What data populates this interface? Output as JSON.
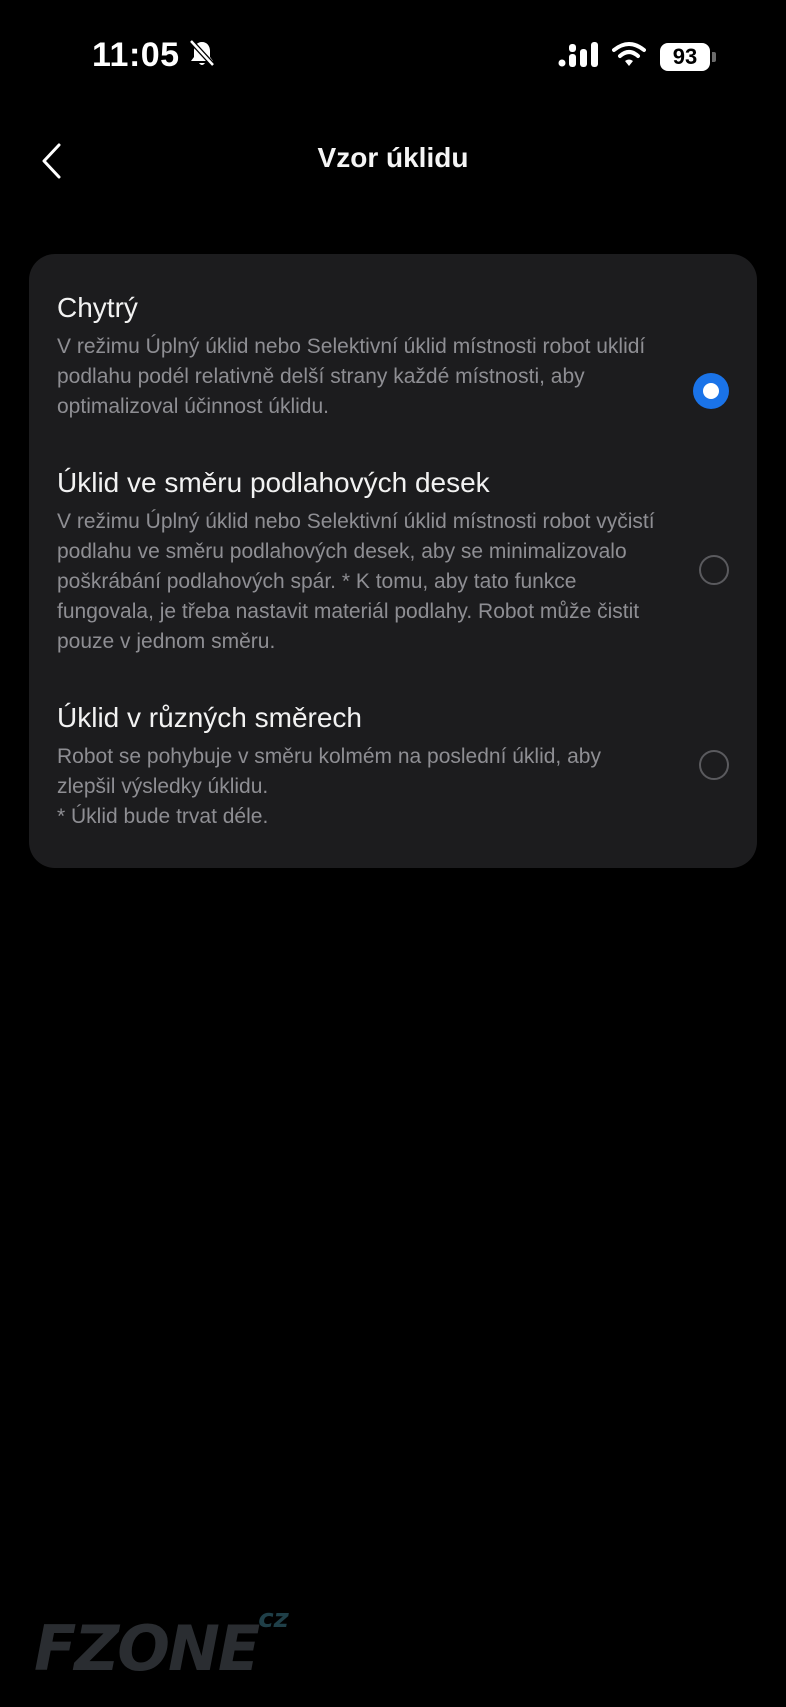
{
  "status_bar": {
    "time": "11:05",
    "battery": "93",
    "icons": [
      "bell-slash-icon",
      "signal-icon",
      "wifi-icon",
      "battery-icon"
    ]
  },
  "header": {
    "title": "Vzor úklidu",
    "back_icon": "chevron-left-icon"
  },
  "options": [
    {
      "title": "Chytrý",
      "description": "V režimu Úplný úklid nebo Selektivní úklid místnosti robot uklidí podlahu podél relativně delší strany každé místnosti, aby optimalizoval účinnost úklidu.",
      "selected": true
    },
    {
      "title": "Úklid ve směru podlahových desek",
      "description": "V režimu Úplný úklid nebo Selektivní úklid místnosti robot vyčistí podlahu ve směru podlahových desek, aby se minimalizovalo poškrábání podlahových spár. * K tomu, aby tato funkce fungovala, je třeba nastavit materiál podlahy. Robot může čistit pouze v jednom směru.",
      "selected": false
    },
    {
      "title": "Úklid v různých směrech",
      "description_line1": "Robot se pohybuje v směru kolmém na poslední úklid, aby zlepšil výsledky úklidu.",
      "description_line2": "* Úklid bude trvat déle.",
      "selected": false
    }
  ],
  "watermark": {
    "text": "FZONE",
    "suffix": "cz"
  },
  "colors": {
    "background": "#000000",
    "card": "#1c1c1e",
    "accent": "#1a73e8",
    "secondary_text": "#8e8e93"
  }
}
